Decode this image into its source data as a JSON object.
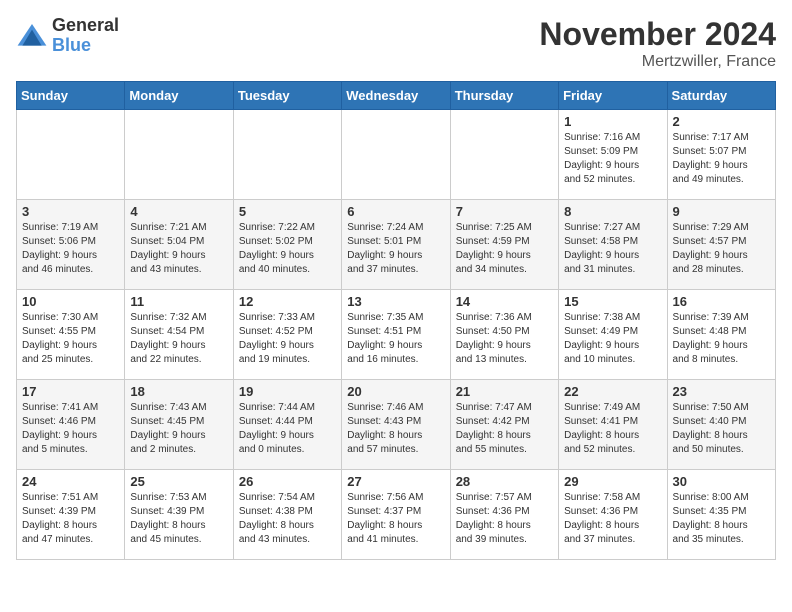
{
  "logo": {
    "general": "General",
    "blue": "Blue"
  },
  "title": "November 2024",
  "location": "Mertzwiller, France",
  "days_of_week": [
    "Sunday",
    "Monday",
    "Tuesday",
    "Wednesday",
    "Thursday",
    "Friday",
    "Saturday"
  ],
  "weeks": [
    [
      {
        "day": "",
        "info": ""
      },
      {
        "day": "",
        "info": ""
      },
      {
        "day": "",
        "info": ""
      },
      {
        "day": "",
        "info": ""
      },
      {
        "day": "",
        "info": ""
      },
      {
        "day": "1",
        "info": "Sunrise: 7:16 AM\nSunset: 5:09 PM\nDaylight: 9 hours\nand 52 minutes."
      },
      {
        "day": "2",
        "info": "Sunrise: 7:17 AM\nSunset: 5:07 PM\nDaylight: 9 hours\nand 49 minutes."
      }
    ],
    [
      {
        "day": "3",
        "info": "Sunrise: 7:19 AM\nSunset: 5:06 PM\nDaylight: 9 hours\nand 46 minutes."
      },
      {
        "day": "4",
        "info": "Sunrise: 7:21 AM\nSunset: 5:04 PM\nDaylight: 9 hours\nand 43 minutes."
      },
      {
        "day": "5",
        "info": "Sunrise: 7:22 AM\nSunset: 5:02 PM\nDaylight: 9 hours\nand 40 minutes."
      },
      {
        "day": "6",
        "info": "Sunrise: 7:24 AM\nSunset: 5:01 PM\nDaylight: 9 hours\nand 37 minutes."
      },
      {
        "day": "7",
        "info": "Sunrise: 7:25 AM\nSunset: 4:59 PM\nDaylight: 9 hours\nand 34 minutes."
      },
      {
        "day": "8",
        "info": "Sunrise: 7:27 AM\nSunset: 4:58 PM\nDaylight: 9 hours\nand 31 minutes."
      },
      {
        "day": "9",
        "info": "Sunrise: 7:29 AM\nSunset: 4:57 PM\nDaylight: 9 hours\nand 28 minutes."
      }
    ],
    [
      {
        "day": "10",
        "info": "Sunrise: 7:30 AM\nSunset: 4:55 PM\nDaylight: 9 hours\nand 25 minutes."
      },
      {
        "day": "11",
        "info": "Sunrise: 7:32 AM\nSunset: 4:54 PM\nDaylight: 9 hours\nand 22 minutes."
      },
      {
        "day": "12",
        "info": "Sunrise: 7:33 AM\nSunset: 4:52 PM\nDaylight: 9 hours\nand 19 minutes."
      },
      {
        "day": "13",
        "info": "Sunrise: 7:35 AM\nSunset: 4:51 PM\nDaylight: 9 hours\nand 16 minutes."
      },
      {
        "day": "14",
        "info": "Sunrise: 7:36 AM\nSunset: 4:50 PM\nDaylight: 9 hours\nand 13 minutes."
      },
      {
        "day": "15",
        "info": "Sunrise: 7:38 AM\nSunset: 4:49 PM\nDaylight: 9 hours\nand 10 minutes."
      },
      {
        "day": "16",
        "info": "Sunrise: 7:39 AM\nSunset: 4:48 PM\nDaylight: 9 hours\nand 8 minutes."
      }
    ],
    [
      {
        "day": "17",
        "info": "Sunrise: 7:41 AM\nSunset: 4:46 PM\nDaylight: 9 hours\nand 5 minutes."
      },
      {
        "day": "18",
        "info": "Sunrise: 7:43 AM\nSunset: 4:45 PM\nDaylight: 9 hours\nand 2 minutes."
      },
      {
        "day": "19",
        "info": "Sunrise: 7:44 AM\nSunset: 4:44 PM\nDaylight: 9 hours\nand 0 minutes."
      },
      {
        "day": "20",
        "info": "Sunrise: 7:46 AM\nSunset: 4:43 PM\nDaylight: 8 hours\nand 57 minutes."
      },
      {
        "day": "21",
        "info": "Sunrise: 7:47 AM\nSunset: 4:42 PM\nDaylight: 8 hours\nand 55 minutes."
      },
      {
        "day": "22",
        "info": "Sunrise: 7:49 AM\nSunset: 4:41 PM\nDaylight: 8 hours\nand 52 minutes."
      },
      {
        "day": "23",
        "info": "Sunrise: 7:50 AM\nSunset: 4:40 PM\nDaylight: 8 hours\nand 50 minutes."
      }
    ],
    [
      {
        "day": "24",
        "info": "Sunrise: 7:51 AM\nSunset: 4:39 PM\nDaylight: 8 hours\nand 47 minutes."
      },
      {
        "day": "25",
        "info": "Sunrise: 7:53 AM\nSunset: 4:39 PM\nDaylight: 8 hours\nand 45 minutes."
      },
      {
        "day": "26",
        "info": "Sunrise: 7:54 AM\nSunset: 4:38 PM\nDaylight: 8 hours\nand 43 minutes."
      },
      {
        "day": "27",
        "info": "Sunrise: 7:56 AM\nSunset: 4:37 PM\nDaylight: 8 hours\nand 41 minutes."
      },
      {
        "day": "28",
        "info": "Sunrise: 7:57 AM\nSunset: 4:36 PM\nDaylight: 8 hours\nand 39 minutes."
      },
      {
        "day": "29",
        "info": "Sunrise: 7:58 AM\nSunset: 4:36 PM\nDaylight: 8 hours\nand 37 minutes."
      },
      {
        "day": "30",
        "info": "Sunrise: 8:00 AM\nSunset: 4:35 PM\nDaylight: 8 hours\nand 35 minutes."
      }
    ]
  ]
}
